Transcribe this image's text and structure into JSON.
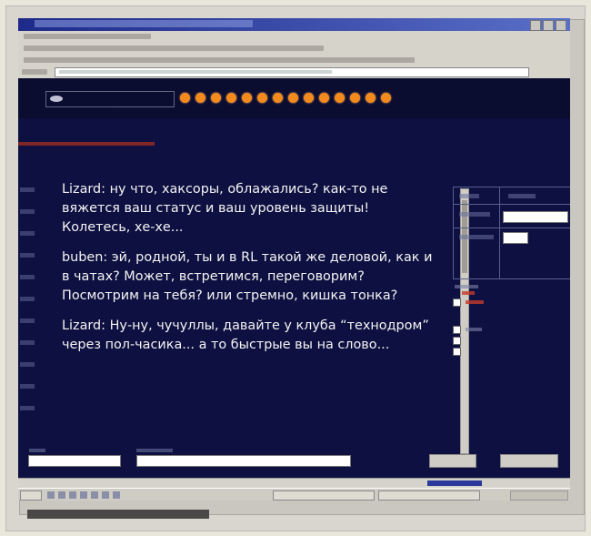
{
  "chat": {
    "messages": [
      "Lizard: ну что, хаксоры, облажались? как-то не вяжется ваш статус и ваш уровень защиты! Колетесь, хе-хе...",
      "buben: эй, родной, ты и в RL такой же деловой, как и в чатах? Может, встретимся, переговорим? Посмотрим на тебя? или стремно, кишка тонка?",
      "Lizard: Ну-ну, чучуллы, давайте у клуба “технодром” через пол-часика... а то быстрые вы на слово..."
    ]
  },
  "colors": {
    "page_bg": "#0d1040",
    "header_bg": "#0a0c30",
    "accent_dots": "#f38a1e",
    "text": "#f4f4f4"
  },
  "icons": {
    "window_controls": [
      "minimize-icon",
      "maximize-icon",
      "close-icon"
    ],
    "brand": "eye-logo-icon"
  }
}
